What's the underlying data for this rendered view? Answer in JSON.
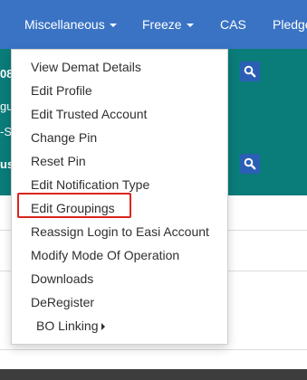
{
  "nav": {
    "miscellaneous": "Miscellaneous",
    "freeze": "Freeze",
    "cas": "CAS",
    "pledge": "Pledge"
  },
  "background": {
    "fragment_1": "08",
    "fragment_2": "gu",
    "fragment_3": "-S",
    "fragment_4": "us"
  },
  "menu": {
    "items": [
      "View Demat Details",
      "Edit Profile",
      "Edit Trusted Account",
      "Change Pin",
      "Reset Pin",
      "Edit Notification Type",
      "Edit Groupings",
      "Reassign Login to Easi Account",
      "Modify Mode Of Operation",
      "Downloads",
      "DeRegister"
    ],
    "bo_linking": "BO Linking"
  },
  "colors": {
    "navbar": "#3a73c4",
    "teal_panel": "#0a7c7a",
    "highlight": "#d9261c"
  }
}
